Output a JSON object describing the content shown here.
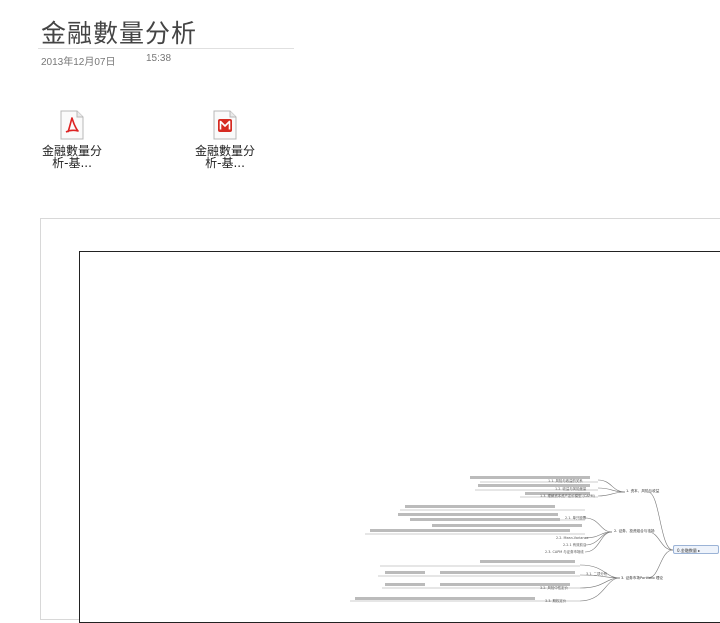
{
  "note": {
    "title": "金融數量分析",
    "date": "2013年12月07日",
    "time": "15:38"
  },
  "attachments": [
    {
      "type": "pdf",
      "icon": "pdf-file-icon",
      "name_line1": "金融數量分",
      "name_line2": "析-基..."
    },
    {
      "type": "mindmap",
      "icon": "mindmanager-file-icon",
      "name_line1": "金融數量分",
      "name_line2": "析-基..."
    }
  ],
  "mindmap": {
    "root": "0.金融数量 ▸",
    "branches": [
      {
        "label": "1. 资本、风险与收益"
      },
      {
        "label": "2. 证券、投资组合与市场"
      },
      {
        "label": "3. 证券市场Portfolio 理论"
      }
    ],
    "nodes": [
      {
        "label": "1.3. 理解资本资产定价模型 (CAPM)"
      },
      {
        "label": "1.2. 收益与风险度量"
      },
      {
        "label": "1.1. 风险与收益的关系"
      },
      {
        "label": "2.1. 单只股票"
      },
      {
        "label": "2.2. Mean-Variance"
      },
      {
        "label": "2.2.1 有效前沿"
      },
      {
        "label": "2.3. CAPM 与证券市场线"
      },
      {
        "label": "3.1. 二项分布"
      },
      {
        "label": "3.2. 风险中性定价"
      },
      {
        "label": "3.3. 期权定价"
      }
    ]
  }
}
